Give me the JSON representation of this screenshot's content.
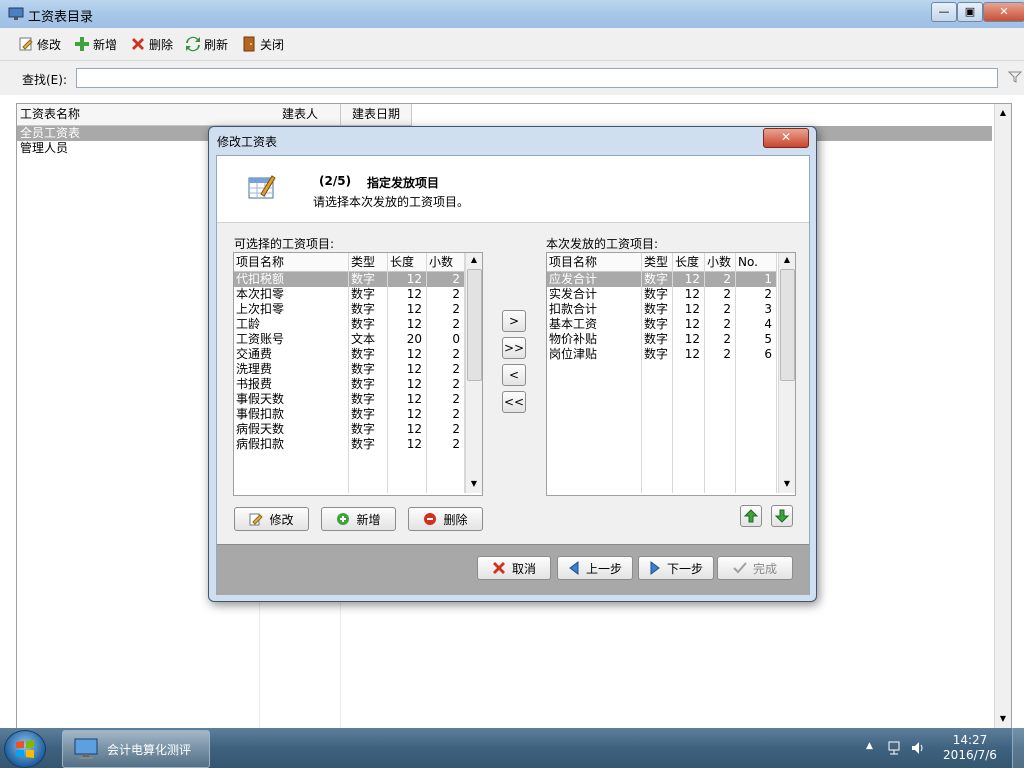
{
  "window": {
    "title": "工资表目录",
    "minimize": "—",
    "maximize": "▣",
    "close": "✕"
  },
  "toolbar": [
    {
      "label": "修改",
      "icon": "edit-icon"
    },
    {
      "label": "新增",
      "icon": "plus-icon"
    },
    {
      "label": "删除",
      "icon": "delete-icon"
    },
    {
      "label": "刷新",
      "icon": "refresh-icon"
    },
    {
      "label": "关闭",
      "icon": "door-icon"
    }
  ],
  "search": {
    "label": "查找(E):",
    "value": ""
  },
  "main_list": {
    "columns": [
      "工资表名称",
      "建表人",
      "建表日期"
    ],
    "rows": [
      {
        "name": "全员工资表",
        "selected": true
      },
      {
        "name": "管理人员",
        "selected": false
      }
    ]
  },
  "dialog": {
    "title": "修改工资表",
    "close": "✕",
    "step": "(2/5)",
    "heading": "指定发放项目",
    "subtitle": "请选择本次发放的工资项目。",
    "available": {
      "label": "可选择的工资项目:",
      "columns": [
        "项目名称",
        "类型",
        "长度",
        "小数"
      ],
      "rows": [
        [
          "代扣税额",
          "数字",
          "12",
          "2"
        ],
        [
          "本次扣零",
          "数字",
          "12",
          "2"
        ],
        [
          "上次扣零",
          "数字",
          "12",
          "2"
        ],
        [
          "工龄",
          "数字",
          "12",
          "2"
        ],
        [
          "工资账号",
          "文本",
          "20",
          "0"
        ],
        [
          "交通费",
          "数字",
          "12",
          "2"
        ],
        [
          "洗理费",
          "数字",
          "12",
          "2"
        ],
        [
          "书报费",
          "数字",
          "12",
          "2"
        ],
        [
          "事假天数",
          "数字",
          "12",
          "2"
        ],
        [
          "事假扣款",
          "数字",
          "12",
          "2"
        ],
        [
          "病假天数",
          "数字",
          "12",
          "2"
        ],
        [
          "病假扣款",
          "数字",
          "12",
          "2"
        ]
      ]
    },
    "selected": {
      "label": "本次发放的工资项目:",
      "columns": [
        "项目名称",
        "类型",
        "长度",
        "小数",
        "No."
      ],
      "rows": [
        [
          "应发合计",
          "数字",
          "12",
          "2",
          "1"
        ],
        [
          "实发合计",
          "数字",
          "12",
          "2",
          "2"
        ],
        [
          "扣款合计",
          "数字",
          "12",
          "2",
          "3"
        ],
        [
          "基本工资",
          "数字",
          "12",
          "2",
          "4"
        ],
        [
          "物价补贴",
          "数字",
          "12",
          "2",
          "5"
        ],
        [
          "岗位津贴",
          "数字",
          "12",
          "2",
          "6"
        ]
      ]
    },
    "move_buttons": [
      ">",
      ">>",
      "<",
      "<<"
    ],
    "item_buttons": {
      "edit": "修改",
      "add": "新增",
      "delete": "删除"
    },
    "footer": {
      "cancel": "取消",
      "prev": "上一步",
      "next": "下一步",
      "finish": "完成"
    }
  },
  "taskbar": {
    "app": "会计电算化测评",
    "time": "14:27",
    "date": "2016/7/6"
  },
  "colors": {
    "selection": "#a9a9a9",
    "footer": "#a8a8a8",
    "green_arrow": "#3da33d",
    "delete_red": "#d0301e"
  }
}
